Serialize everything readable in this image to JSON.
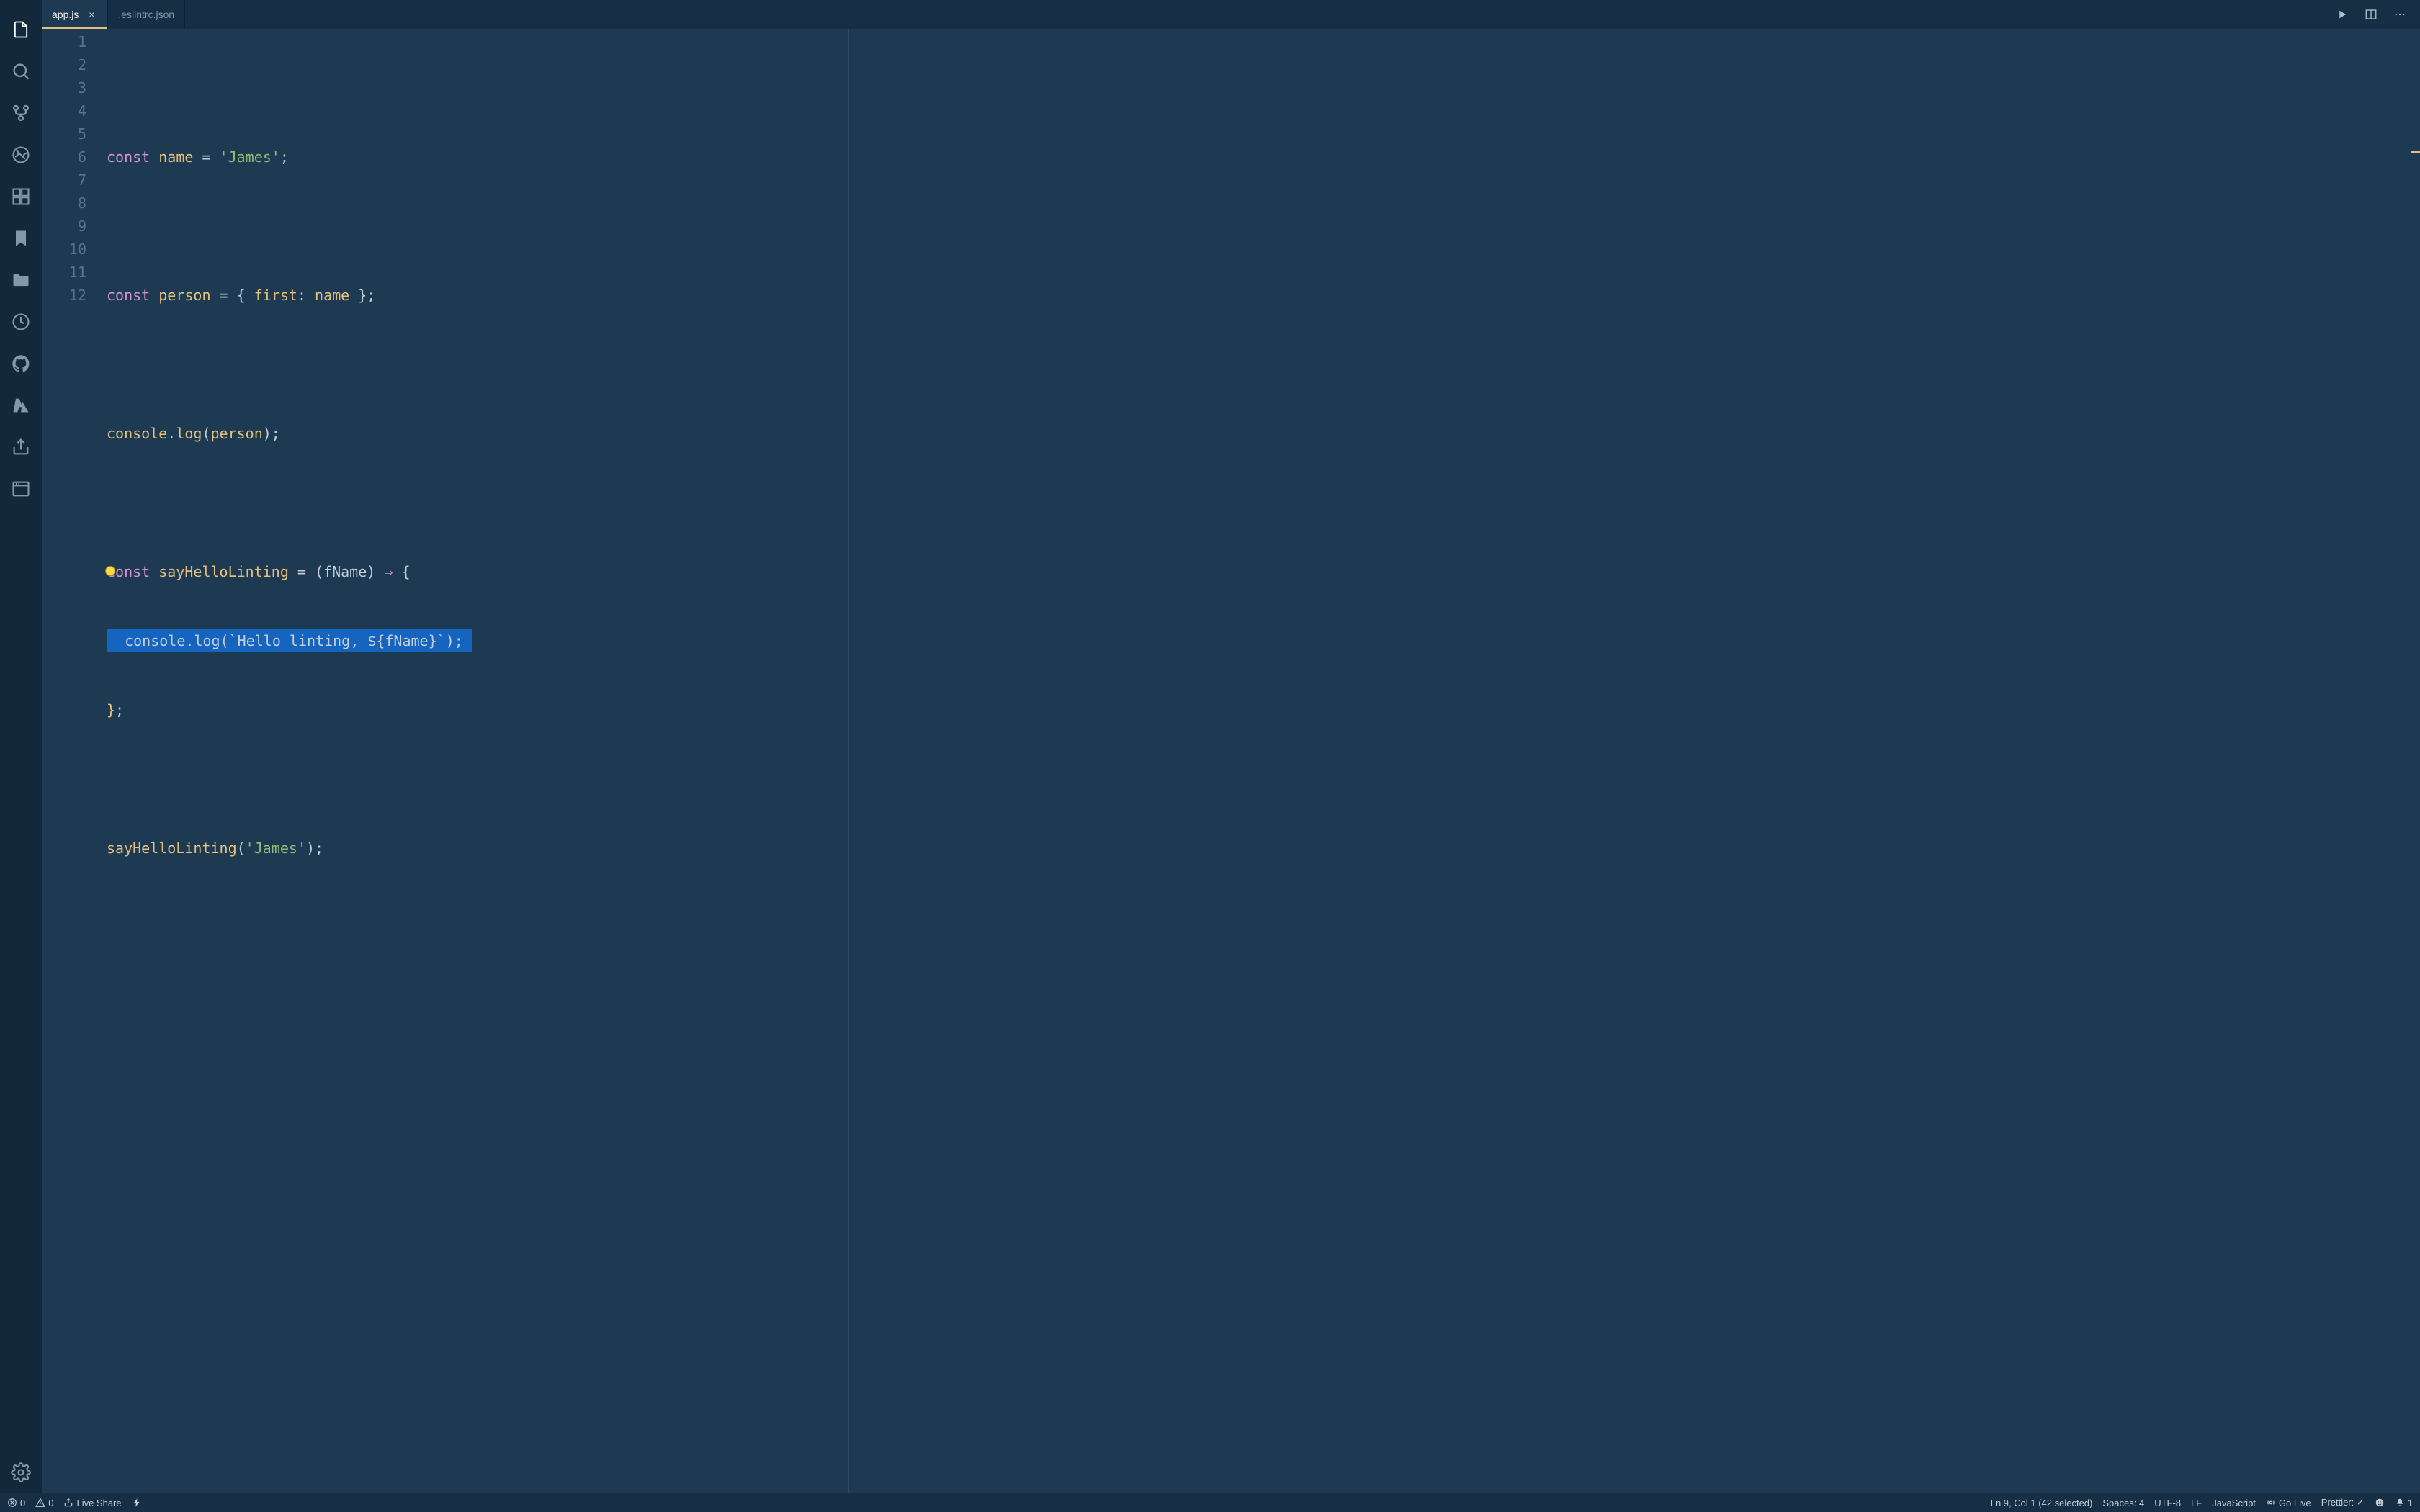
{
  "tabs": [
    {
      "label": "app.js",
      "active": true
    },
    {
      "label": ".eslintrc.json",
      "active": false
    }
  ],
  "lineNumbers": [
    "1",
    "2",
    "3",
    "4",
    "5",
    "6",
    "7",
    "8",
    "9",
    "10",
    "11",
    "12"
  ],
  "code": {
    "line1": {
      "const": "const",
      "name": "name",
      "eq": " = ",
      "str": "'James'",
      "semi": ";"
    },
    "line3": {
      "const": "const",
      "person": "person",
      "eq": " = { ",
      "first": "first",
      "colon": ": ",
      "name": "name",
      "close": " };"
    },
    "line5": {
      "console": "console",
      "dot": ".",
      "log": "log",
      "open": "(",
      "person": "person",
      "close": ");"
    },
    "line7": {
      "const": "const",
      "fn": "sayHelloLinting",
      "rest": " = (",
      "param": "fName",
      "arrow": ") => {",
      "arrow_sym": " ⇒ "
    },
    "line8": {
      "indent": "  ",
      "console": "console",
      "dot": ".",
      "log": "log",
      "open": "(",
      "backtick1": "`",
      "tmpl": "Hello linting, ",
      "interp_open": "${",
      "interp_var": "fName",
      "interp_close": "}",
      "backtick2": "`",
      "close": ");"
    },
    "line9": {
      "brace": "}",
      "semi": ";"
    },
    "line11": {
      "fn": "sayHelloLinting",
      "open": "(",
      "str": "'James'",
      "close": ");"
    }
  },
  "status": {
    "errors": "0",
    "warnings": "0",
    "liveShare": "Live Share",
    "cursor": "Ln 9, Col 1 (42 selected)",
    "spaces": "Spaces: 4",
    "encoding": "UTF-8",
    "eol": "LF",
    "language": "JavaScript",
    "goLive": "Go Live",
    "prettier": "Prettier: ✓",
    "bell": "1"
  }
}
